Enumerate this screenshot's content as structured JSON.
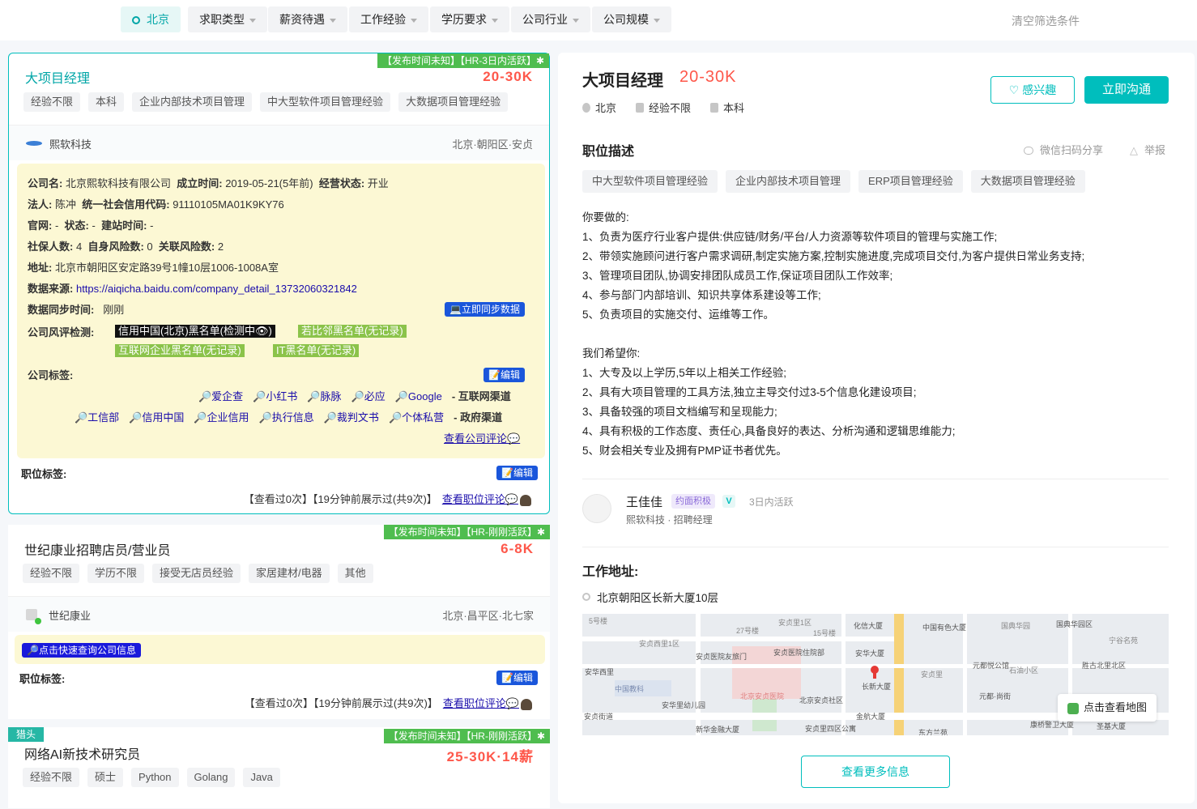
{
  "filters": {
    "city": "北京",
    "items": [
      "求职类型",
      "薪资待遇",
      "工作经验",
      "学历要求",
      "公司行业",
      "公司规模"
    ],
    "clear": "清空筛选条件"
  },
  "jobs": [
    {
      "corner": "【发布时间未知】【HR-3日内活跃】✱",
      "title": "大项目经理",
      "salary": "20-30K",
      "tags": [
        "经验不限",
        "本科",
        "企业内部技术项目管理",
        "中大型软件项目管理经验",
        "大数据项目管理经验"
      ],
      "company": "熙软科技",
      "location": "北京·朝阳区·安贞",
      "info": {
        "l_name": "公司名:",
        "v_name": "北京熙软科技有限公司",
        "l_est": "成立时间:",
        "v_est": "2019-05-21(5年前)",
        "l_status": "经营状态:",
        "v_status": "开业",
        "l_legal": "法人:",
        "v_legal": "陈冲",
        "l_credit": "统一社会信用代码:",
        "v_credit": "91110105MA01K9KY76",
        "l_site": "官网:",
        "v_site": "-",
        "l_state": "状态:",
        "v_state": "-",
        "l_build": "建站时间:",
        "v_build": "-",
        "l_ss": "社保人数:",
        "v_ss": "4",
        "l_self": "自身风险数:",
        "v_self": "0",
        "l_rel": "关联风险数:",
        "v_rel": "2",
        "l_addr": "地址:",
        "v_addr": "北京市朝阳区安定路39号1幢10层1006-1008A室",
        "l_src": "数据来源:",
        "v_src": "https://aiqicha.baidu.com/company_detail_13732060321842",
        "l_sync": "数据同步时间:",
        "v_sync": "刚刚",
        "sync_btn": "💻立即同步数据",
        "l_risk": "公司风评检测:",
        "risk1": "信用中国(北京)黑名单(检测中👁)",
        "risk2": "若比邻黑名单(无记录)",
        "risk3": "互联网企业黑名单(无记录)",
        "risk4": "IT黑名单(无记录)",
        "l_ctag": "公司标签:",
        "edit": "📝编辑",
        "web": [
          "🔎爱企查",
          "🔎小红书",
          "🔎脉脉",
          "🔎必应",
          "🔎Google"
        ],
        "web_label": "- 互联网渠道",
        "gov": [
          "🔎工信部",
          "🔎信用中国",
          "🔎企业信用",
          "🔎执行信息",
          "🔎裁判文书",
          "🔎个体私营"
        ],
        "gov_label": "- 政府渠道",
        "review": "查看公司评论💬"
      },
      "jtag_label": "职位标签:",
      "edit": "📝编辑",
      "foot": "【查看过0次】【19分钟前展示过(共9次)】",
      "foot_link": "查看职位评论💬"
    },
    {
      "corner": "【发布时间未知】【HR-刚刚活跃】✱",
      "title": "世纪康业招聘店员/营业员",
      "salary": "6-8K",
      "tags": [
        "经验不限",
        "学历不限",
        "接受无店员经验",
        "家居建材/电器",
        "其他"
      ],
      "company": "世纪康业",
      "location": "北京·昌平区·北七家",
      "quick": "🔎点击快速查询公司信息",
      "jtag_label": "职位标签:",
      "edit": "📝编辑",
      "foot": "【查看过0次】【19分钟前展示过(共9次)】",
      "foot_link": "查看职位评论💬"
    },
    {
      "hunter": "猎头",
      "corner": "【发布时间未知】【HR-刚刚活跃】✱",
      "title": "网络AI新技术研究员",
      "salary": "25-30K·14薪",
      "tags": [
        "经验不限",
        "硕士",
        "Python",
        "Golang",
        "Java"
      ]
    }
  ],
  "detail": {
    "title": "大项目经理",
    "salary": "20-30K",
    "city": "北京",
    "exp": "经验不限",
    "edu": "本科",
    "interest": "♡ 感兴趣",
    "chat": "立即沟通",
    "desc_title": "职位描述",
    "share": "微信扫码分享",
    "report": "举报",
    "tags": [
      "中大型软件项目管理经验",
      "企业内部技术项目管理",
      "ERP项目管理经验",
      "大数据项目管理经验"
    ],
    "lines": [
      "你要做的:",
      "1、负责为医疗行业客户提供:供应链/财务/平台/人力资源等软件项目的管理与实施工作;",
      "2、带领实施顾问进行客户需求调研,制定实施方案,控制实施进度,完成项目交付,为客户提供日常业务支持;",
      "3、管理项目团队,协调安排团队成员工作,保证项目团队工作效率;",
      "4、参与部门内部培训、知识共享体系建设等工作;",
      "5、负责项目的实施交付、运维等工作。",
      "",
      "我们希望你:",
      "1、大专及以上学历,5年以上相关工作经验;",
      "2、具有大项目管理的工具方法,独立主导交付过3-5个信息化建设项目;",
      "3、具备较强的项目文档编写和呈现能力;",
      "4、具有积极的工作态度、责任心,具备良好的表达、分析沟通和逻辑思维能力;",
      "5、财会相关专业及拥有PMP证书者优先。"
    ],
    "recruiter": {
      "name": "王佳佳",
      "badge": "约面积极",
      "v": "V",
      "active": "3日内活跃",
      "company": "熙软科技 · 招聘经理"
    },
    "addr_title": "工作地址:",
    "addr": "北京朝阳区长新大厦10层",
    "map": {
      "btn": "点击查看地图",
      "labels": [
        "安贞里1区",
        "化信大厦",
        "中国有色大厦",
        "国典华园",
        "国典华园区",
        "5号楼",
        "27号楼",
        "15号楼",
        "安贞西里1区",
        "安贞医院友旅门",
        "安贞医院住院部",
        "安华大厦",
        "安贞里",
        "元都悦公馆",
        "胜古北里北区",
        "中国教科",
        "安华里幼儿园",
        "北京安贞医院",
        "北京安贞社区",
        "长新大厦",
        "安华西里",
        "安贞街道",
        "元都·尚街",
        "石油小区",
        "新华金融大厦",
        "安贞里四区公寓",
        "金航大厦",
        "东方兰苑",
        "康桥警卫大厦",
        "圣基大厦",
        "宁谷名苑"
      ]
    },
    "more": "查看更多信息"
  }
}
